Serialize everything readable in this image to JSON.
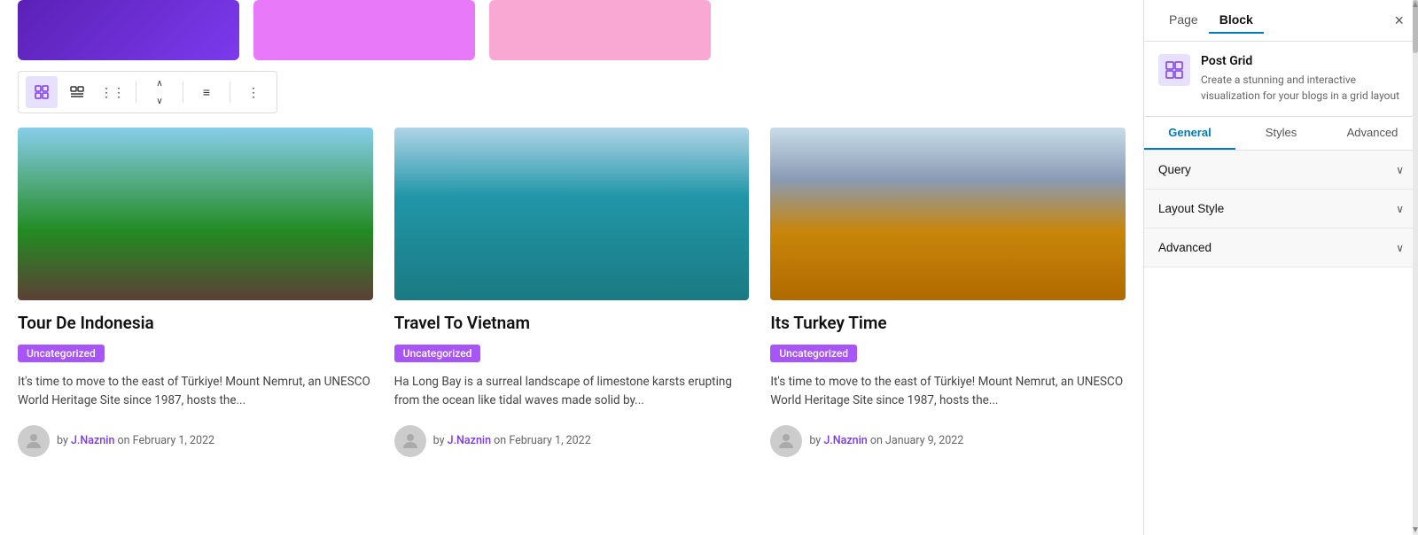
{
  "sidebar": {
    "page_tab": "Page",
    "block_tab": "Block",
    "close_label": "×",
    "block_icon": "⊞",
    "block_name": "Post Grid",
    "block_description": "Create a stunning and interactive visualization for your blogs in a grid layout",
    "tabs": {
      "general": "General",
      "styles": "Styles",
      "advanced": "Advanced"
    },
    "accordion": {
      "query_label": "Query",
      "layout_style_label": "Layout Style",
      "advanced_label": "Advanced"
    }
  },
  "toolbar": {
    "btn1": "⊞",
    "btn2": "⊟",
    "btn3": "⋮⋮",
    "btn4_up": "∧",
    "btn4_down": "∨",
    "btn5": "≡",
    "btn6": "⋮"
  },
  "posts": [
    {
      "title": "Tour De Indonesia",
      "category": "Uncategorized",
      "excerpt": "It's time to move to the east of Türkiye! Mount Nemrut, an UNESCO World Heritage Site since 1987, hosts the...",
      "author": "J.Naznin",
      "date": "February 1, 2022",
      "author_prefix": "by",
      "date_prefix": "on"
    },
    {
      "title": "Travel To Vietnam",
      "category": "Uncategorized",
      "excerpt": "Ha Long Bay is a surreal landscape of limestone karsts erupting from the ocean like tidal waves made solid by...",
      "author": "J.Naznin",
      "date": "February 1, 2022",
      "author_prefix": "by",
      "date_prefix": "on"
    },
    {
      "title": "Its Turkey Time",
      "category": "Uncategorized",
      "excerpt": "It's time to move to the east of Türkiye! Mount Nemrut, an UNESCO World Heritage Site since 1987, hosts the...",
      "author": "J.Naznin",
      "date": "January 9, 2022",
      "author_prefix": "by",
      "date_prefix": "on"
    }
  ],
  "swatches": {
    "colors": [
      "purple",
      "pink",
      "light-pink"
    ]
  }
}
